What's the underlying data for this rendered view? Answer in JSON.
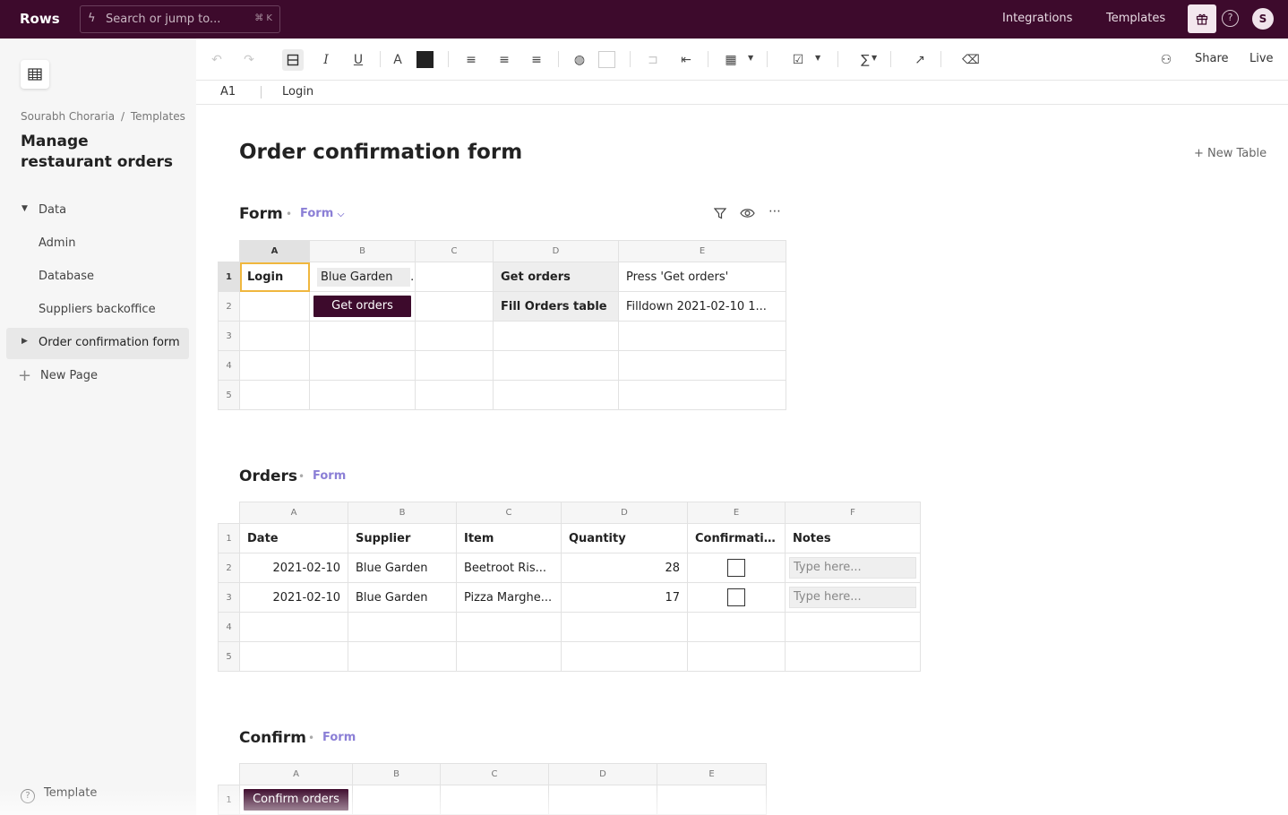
{
  "app": {
    "logo": "Rows",
    "search_placeholder": "Search or jump to...",
    "search_shortcut": "⌘ K",
    "nav_integrations": "Integrations",
    "nav_templates": "Templates",
    "avatar_initial": "S",
    "brand_color": "#3d0a2c"
  },
  "sidebar": {
    "breadcrumb_owner": "Sourabh Choraria",
    "breadcrumb_sep": "/",
    "breadcrumb_folder": "Templates",
    "doc_title": "Manage restaurant orders",
    "items": [
      {
        "label": "Data"
      },
      {
        "label": "Admin"
      },
      {
        "label": "Database"
      },
      {
        "label": "Suppliers backoffice"
      },
      {
        "label": "Order confirmation form"
      },
      {
        "label": "New Page"
      }
    ],
    "footer": "Template"
  },
  "toolbar": {
    "share": "Share",
    "live": "Live"
  },
  "formula_bar": {
    "cell_ref": "A1",
    "value": "Login"
  },
  "page": {
    "title": "Order confirmation form",
    "new_table": "+ New Table"
  },
  "tables": {
    "form": {
      "title": "Form",
      "view": "Form",
      "columns": [
        "A",
        "B",
        "C",
        "D",
        "E"
      ],
      "rows": [
        "1",
        "2",
        "3",
        "4",
        "5"
      ],
      "a1": "Login",
      "b1": "Blue Garden",
      "b2_button": "Get orders",
      "d1": "Get orders",
      "e1": "Press 'Get orders'",
      "d2": "Fill Orders table",
      "e2": "Filldown 2021-02-10 1..."
    },
    "orders": {
      "title": "Orders",
      "view": "Form",
      "columns": [
        "A",
        "B",
        "C",
        "D",
        "E",
        "F"
      ],
      "rows": [
        "1",
        "2",
        "3",
        "4",
        "5"
      ],
      "headers": [
        "Date",
        "Supplier",
        "Item",
        "Quantity",
        "Confirmation",
        "Notes"
      ],
      "data": [
        {
          "date": "2021-02-10",
          "supplier": "Blue Garden",
          "item": "Beetroot Ris...",
          "quantity": "28",
          "confirmed": false,
          "notes_placeholder": "Type here..."
        },
        {
          "date": "2021-02-10",
          "supplier": "Blue Garden",
          "item": "Pizza Marghe...",
          "quantity": "17",
          "confirmed": false,
          "notes_placeholder": "Type here..."
        }
      ]
    },
    "confirm": {
      "title": "Confirm",
      "view": "Form",
      "columns": [
        "A",
        "B",
        "C",
        "D",
        "E"
      ],
      "rows": [
        "1"
      ],
      "a1_button": "Confirm orders"
    }
  }
}
